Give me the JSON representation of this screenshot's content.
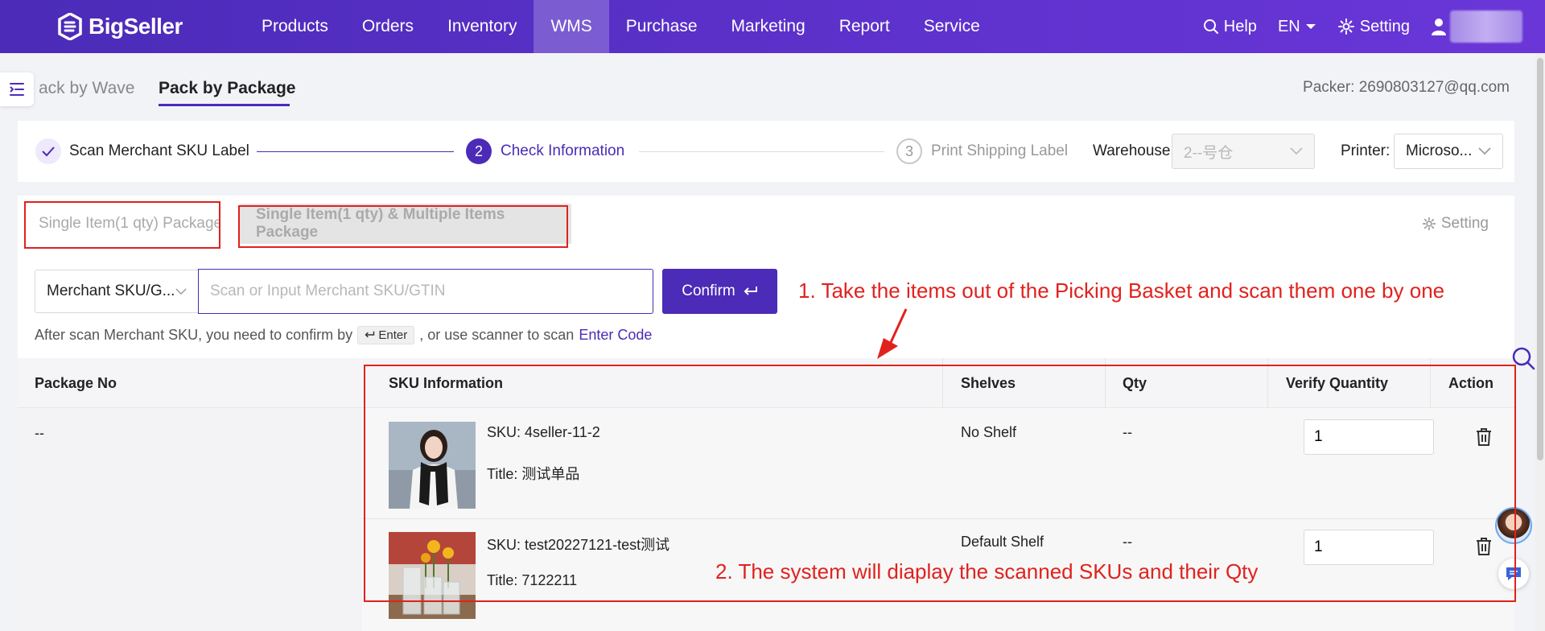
{
  "brand": {
    "name": "BigSeller"
  },
  "nav": {
    "items": [
      {
        "label": "Products"
      },
      {
        "label": "Orders"
      },
      {
        "label": "Inventory"
      },
      {
        "label": "WMS",
        "active": true
      },
      {
        "label": "Purchase"
      },
      {
        "label": "Marketing"
      },
      {
        "label": "Report"
      },
      {
        "label": "Service"
      }
    ],
    "help": "Help",
    "language": "EN",
    "setting": "Setting"
  },
  "tabs": {
    "wave": "Pack by Wave",
    "package": "Pack by Package"
  },
  "packer": "Packer: 2690803127@qq.com",
  "steps": {
    "step1": {
      "label": "Scan Merchant SKU Label"
    },
    "step2": {
      "number": "2",
      "label": "Check Information"
    },
    "step3": {
      "number": "3",
      "label": "Print Shipping Label"
    },
    "warehouse_label": "Warehouse:",
    "warehouse_value": "2--号仓",
    "printer_label": "Printer:",
    "printer_value": "Microso..."
  },
  "package_types": {
    "single": "Single Item(1 qty) Package",
    "multiple": "Single Item(1 qty) & Multiple Items Package",
    "setting": "Setting"
  },
  "scan": {
    "type_value": "Merchant SKU/G...",
    "placeholder": "Scan or Input Merchant SKU/GTIN",
    "confirm": "Confirm",
    "hint_before": "After scan Merchant SKU, you need to confirm by",
    "hint_key": "Enter",
    "hint_after": ", or use scanner to scan",
    "hint_link": "Enter Code"
  },
  "table": {
    "headers": {
      "package_no": "Package No",
      "sku_info": "SKU Information",
      "shelves": "Shelves",
      "qty": "Qty",
      "verify": "Verify Quantity",
      "action": "Action"
    },
    "package_no": "--",
    "rows": [
      {
        "sku": "SKU: 4seller-11-2",
        "title": "Title: 测试单品",
        "shelf": "No Shelf",
        "qty": "--",
        "verify": "1"
      },
      {
        "sku": "SKU: test20227121-test测试",
        "title": "Title: 7122211",
        "shelf": "Default Shelf",
        "qty": "--",
        "verify": "1"
      }
    ]
  },
  "annotations": {
    "note1": "1. Take the items out of the Picking Basket and scan them one by one",
    "note2": "2. The system will diaplay the scanned SKUs and their Qty"
  },
  "colors": {
    "primary": "#4b2bb8",
    "annotation": "#e0221e"
  }
}
